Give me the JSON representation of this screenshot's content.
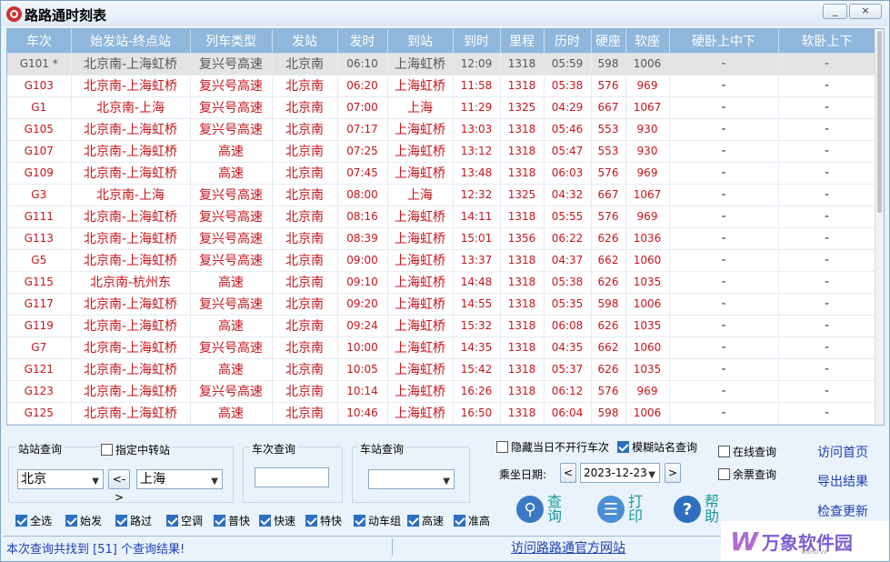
{
  "window": {
    "title": "路路通时刻表",
    "min_label": "_",
    "close_label": "×"
  },
  "table": {
    "headers": [
      "车次",
      "始发站-终点站",
      "列车类型",
      "发站",
      "发时",
      "到站",
      "到时",
      "里程",
      "历时",
      "硬座",
      "软座",
      "硬卧上中下",
      "软卧上下"
    ],
    "rows": [
      [
        "G101 *",
        "北京南-上海虹桥",
        "复兴号高速",
        "北京南",
        "06:10",
        "上海虹桥",
        "12:09",
        "1318",
        "05:59",
        "598",
        "1006",
        "-",
        "-"
      ],
      [
        "G103",
        "北京南-上海虹桥",
        "复兴号高速",
        "北京南",
        "06:20",
        "上海虹桥",
        "11:58",
        "1318",
        "05:38",
        "576",
        "969",
        "-",
        "-"
      ],
      [
        "G1",
        "北京南-上海",
        "复兴号高速",
        "北京南",
        "07:00",
        "上海",
        "11:29",
        "1325",
        "04:29",
        "667",
        "1067",
        "-",
        "-"
      ],
      [
        "G105",
        "北京南-上海虹桥",
        "复兴号高速",
        "北京南",
        "07:17",
        "上海虹桥",
        "13:03",
        "1318",
        "05:46",
        "553",
        "930",
        "-",
        "-"
      ],
      [
        "G107",
        "北京南-上海虹桥",
        "高速",
        "北京南",
        "07:25",
        "上海虹桥",
        "13:12",
        "1318",
        "05:47",
        "553",
        "930",
        "-",
        "-"
      ],
      [
        "G109",
        "北京南-上海虹桥",
        "高速",
        "北京南",
        "07:45",
        "上海虹桥",
        "13:48",
        "1318",
        "06:03",
        "576",
        "969",
        "-",
        "-"
      ],
      [
        "G3",
        "北京南-上海",
        "复兴号高速",
        "北京南",
        "08:00",
        "上海",
        "12:32",
        "1325",
        "04:32",
        "667",
        "1067",
        "-",
        "-"
      ],
      [
        "G111",
        "北京南-上海虹桥",
        "复兴号高速",
        "北京南",
        "08:16",
        "上海虹桥",
        "14:11",
        "1318",
        "05:55",
        "576",
        "969",
        "-",
        "-"
      ],
      [
        "G113",
        "北京南-上海虹桥",
        "复兴号高速",
        "北京南",
        "08:39",
        "上海虹桥",
        "15:01",
        "1356",
        "06:22",
        "626",
        "1036",
        "-",
        "-"
      ],
      [
        "G5",
        "北京南-上海虹桥",
        "复兴号高速",
        "北京南",
        "09:00",
        "上海虹桥",
        "13:37",
        "1318",
        "04:37",
        "662",
        "1060",
        "-",
        "-"
      ],
      [
        "G115",
        "北京南-杭州东",
        "高速",
        "北京南",
        "09:10",
        "上海虹桥",
        "14:48",
        "1318",
        "05:38",
        "626",
        "1035",
        "-",
        "-"
      ],
      [
        "G117",
        "北京南-上海虹桥",
        "复兴号高速",
        "北京南",
        "09:20",
        "上海虹桥",
        "14:55",
        "1318",
        "05:35",
        "598",
        "1006",
        "-",
        "-"
      ],
      [
        "G119",
        "北京南-上海虹桥",
        "高速",
        "北京南",
        "09:24",
        "上海虹桥",
        "15:32",
        "1318",
        "06:08",
        "626",
        "1035",
        "-",
        "-"
      ],
      [
        "G7",
        "北京南-上海虹桥",
        "复兴号高速",
        "北京南",
        "10:00",
        "上海虹桥",
        "14:35",
        "1318",
        "04:35",
        "662",
        "1060",
        "-",
        "-"
      ],
      [
        "G121",
        "北京南-上海虹桥",
        "高速",
        "北京南",
        "10:05",
        "上海虹桥",
        "15:42",
        "1318",
        "05:37",
        "626",
        "1035",
        "-",
        "-"
      ],
      [
        "G123",
        "北京南-上海虹桥",
        "复兴号高速",
        "北京南",
        "10:14",
        "上海虹桥",
        "16:26",
        "1318",
        "06:12",
        "576",
        "969",
        "-",
        "-"
      ],
      [
        "G125",
        "北京南-上海虹桥",
        "高速",
        "北京南",
        "10:46",
        "上海虹桥",
        "16:50",
        "1318",
        "06:04",
        "598",
        "1006",
        "-",
        "-"
      ]
    ]
  },
  "station_query": {
    "label": "站站查询",
    "transfer_label": "指定中转站",
    "from": "北京",
    "to": "上海",
    "swap_label": "<->"
  },
  "train_query": {
    "label": "车次查询",
    "value": ""
  },
  "station_lookup": {
    "label": "车站查询",
    "value": ""
  },
  "options": {
    "hide_label": "隐藏当日不开行车次",
    "fuzzy_label": "模糊站名查询",
    "online_label": "在线查询",
    "remaining_label": "余票查询",
    "date_label": "乘坐日期:",
    "date_value": "2023-12-23",
    "prev": "<",
    "next": ">"
  },
  "filters": [
    "全选",
    "始发",
    "路过",
    "空调",
    "普快",
    "快速",
    "特快",
    "动车组",
    "高速",
    "准高"
  ],
  "actions": {
    "query": "查询",
    "print": "打印",
    "help": "帮助"
  },
  "links": {
    "home": "访问首页",
    "export": "导出结果",
    "update": "检查更新"
  },
  "status": {
    "result_text": "本次查询共找到 [51] 个查询结果!",
    "site_link": "访问路路通官方网站"
  },
  "watermark": {
    "logo": "W",
    "text": "万象软件园",
    "sub": "WXHD.VIP"
  }
}
